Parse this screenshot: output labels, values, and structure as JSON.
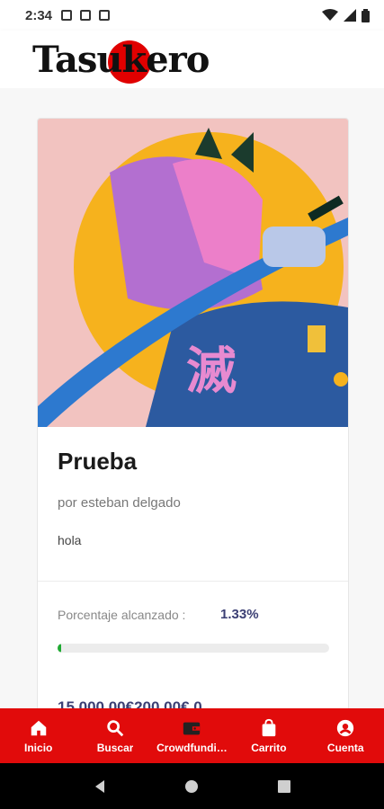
{
  "status_bar": {
    "time": "2:34"
  },
  "header": {
    "logo_text": "Tasukero",
    "logo_left": "Tas",
    "logo_mid": "uk",
    "logo_right": "ero"
  },
  "project": {
    "title": "Prueba",
    "author": "por esteban delgado",
    "description": "hola",
    "percent_label": "Porcentaje alcanzado :",
    "percent_value": "1.33%",
    "progress": 0.0133,
    "amounts": "15.000,00€200,00€ 0"
  },
  "bottom_nav": [
    {
      "label": "Inicio",
      "icon": "home-icon"
    },
    {
      "label": "Buscar",
      "icon": "search-icon"
    },
    {
      "label": "Crowdfundi…",
      "icon": "wallet-icon"
    },
    {
      "label": "Carrito",
      "icon": "shopping-bag-icon"
    },
    {
      "label": "Cuenta",
      "icon": "account-circle-icon"
    }
  ],
  "colors": {
    "brand_red": "#e10b0b",
    "progress_green": "#1faa32",
    "value_blue": "#3b3f74"
  }
}
